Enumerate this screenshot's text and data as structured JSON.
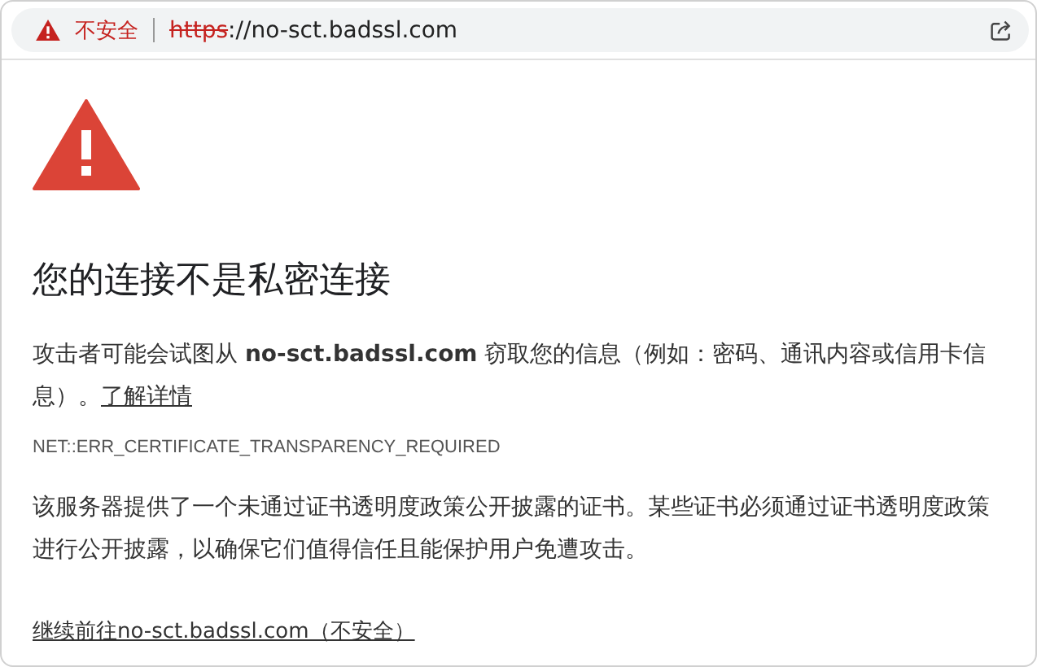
{
  "address_bar": {
    "security_label": "不安全",
    "scheme": "https",
    "scheme_struck": true,
    "rest": "://no-sct.badssl.com"
  },
  "heading": "您的连接不是私密连接",
  "description": "攻击者可能会试图从 **no-sct.badssl.com** 窃取您的信息（例如：密码、通讯内容或信用卡信息）。",
  "learn_more_link": "了解详情",
  "error_code": "NET::ERR_CERTIFICATE_TRANSPARENCY_REQUIRED",
  "explanation": "该服务器提供了一个未通过证书透明度政策公开披露的证书。某些证书必须通过证书透明度政策进行公开披露，以确保它们值得信任且能保护用户免遭攻击。",
  "proceed_link": "继续前往no-sct.badssl.com（不安全）"
}
